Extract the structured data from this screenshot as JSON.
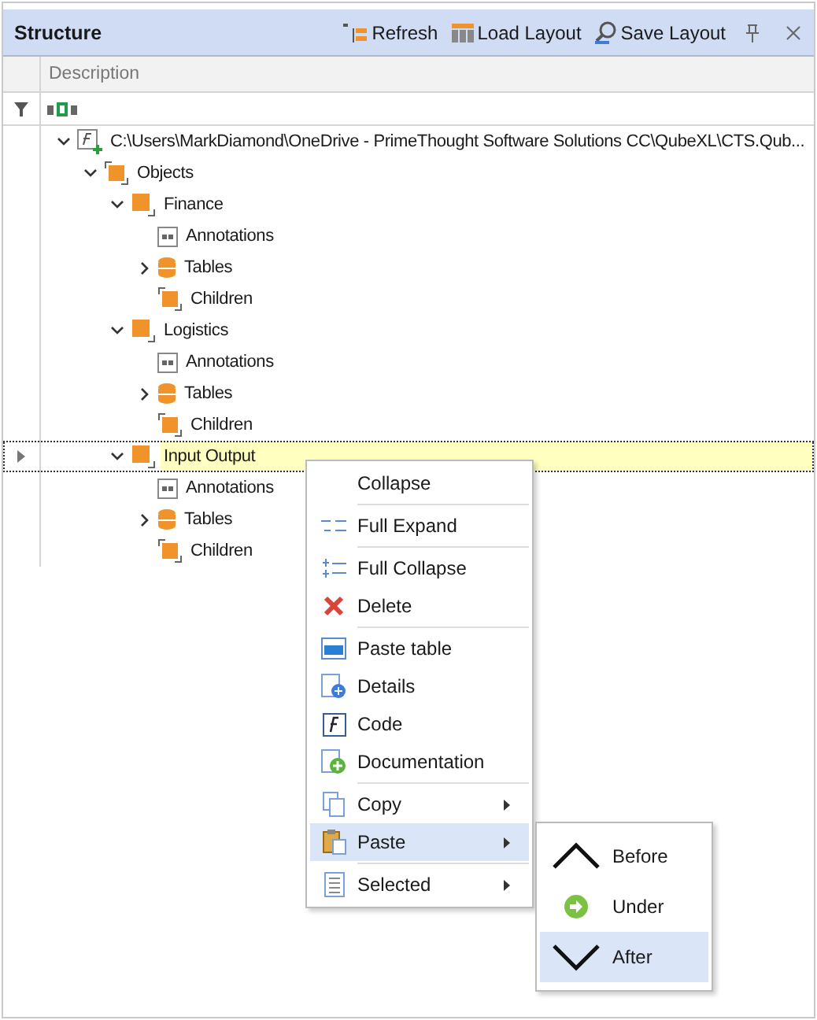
{
  "panel": {
    "title": "Structure",
    "toolbar": [
      {
        "label": "Refresh"
      },
      {
        "label": "Load Layout"
      },
      {
        "label": "Save Layout"
      }
    ]
  },
  "column": {
    "label": "Description"
  },
  "tree": [
    {
      "label": "C:\\Users\\MarkDiamond\\OneDrive - PrimeThought Software Solutions CC\\QubeXL\\CTS.Qub...",
      "kind": "formula",
      "expanded": true,
      "selected": false,
      "children": [
        {
          "label": "Objects",
          "kind": "group",
          "expanded": true,
          "selected": false,
          "children": [
            {
              "label": "Finance",
              "kind": "object",
              "expanded": true,
              "selected": false,
              "children": [
                {
                  "label": "Annotations",
                  "kind": "annotation",
                  "selected": false
                },
                {
                  "label": "Tables",
                  "kind": "table",
                  "expanded": false,
                  "selected": false
                },
                {
                  "label": "Children",
                  "kind": "group",
                  "selected": false
                }
              ]
            },
            {
              "label": "Logistics",
              "kind": "object",
              "expanded": true,
              "selected": false,
              "children": [
                {
                  "label": "Annotations",
                  "kind": "annotation",
                  "selected": false
                },
                {
                  "label": "Tables",
                  "kind": "table",
                  "expanded": false,
                  "selected": false
                },
                {
                  "label": "Children",
                  "kind": "group",
                  "selected": false
                }
              ]
            },
            {
              "label": "Input Output",
              "kind": "object",
              "expanded": true,
              "selected": true,
              "children": [
                {
                  "label": "Annotations",
                  "kind": "annotation",
                  "selected": false
                },
                {
                  "label": "Tables",
                  "kind": "table",
                  "expanded": false,
                  "selected": false
                },
                {
                  "label": "Children",
                  "kind": "group",
                  "selected": false
                }
              ]
            }
          ]
        }
      ]
    }
  ],
  "context_menu": {
    "items": [
      {
        "label": "Collapse",
        "separator_before": false,
        "submenu": false,
        "selected": false
      },
      {
        "label": "Full Expand",
        "separator_before": true,
        "submenu": false,
        "selected": false
      },
      {
        "label": "Full Collapse",
        "separator_before": true,
        "submenu": false,
        "selected": false
      },
      {
        "label": "Delete",
        "separator_before": false,
        "submenu": false,
        "selected": false
      },
      {
        "label": "Paste table",
        "separator_before": true,
        "submenu": false,
        "selected": false
      },
      {
        "label": "Details",
        "separator_before": false,
        "submenu": false,
        "selected": false
      },
      {
        "label": "Code",
        "separator_before": false,
        "submenu": false,
        "selected": false
      },
      {
        "label": "Documentation",
        "separator_before": false,
        "submenu": false,
        "selected": false
      },
      {
        "label": "Copy",
        "separator_before": true,
        "submenu": true,
        "selected": false
      },
      {
        "label": "Paste",
        "separator_before": false,
        "submenu": true,
        "selected": true
      },
      {
        "label": "Selected",
        "separator_before": true,
        "submenu": true,
        "selected": false
      }
    ]
  },
  "submenu": {
    "items": [
      {
        "label": "Before",
        "selected": false
      },
      {
        "label": "Under",
        "selected": false
      },
      {
        "label": "After",
        "selected": true
      }
    ]
  }
}
